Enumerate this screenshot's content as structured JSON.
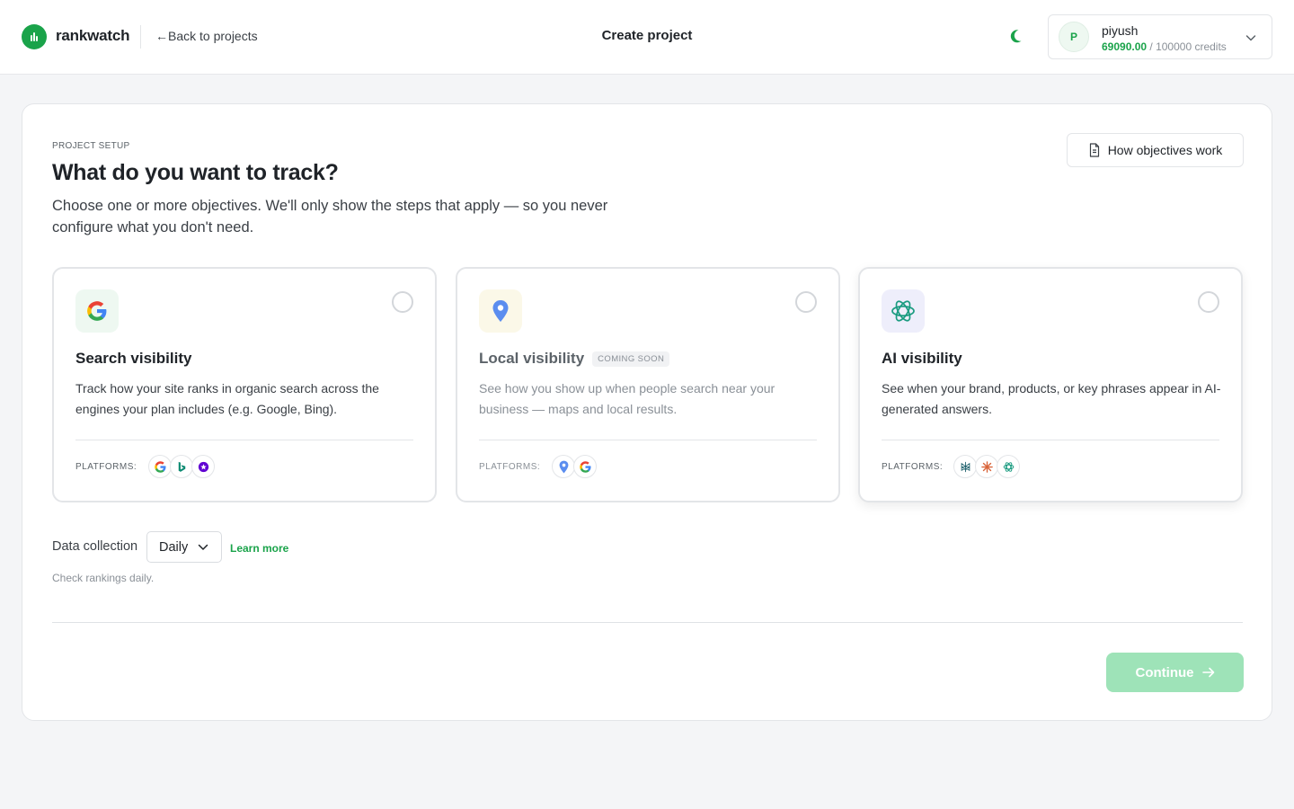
{
  "header": {
    "brand": "rankwatch",
    "back_link": "←Back to projects",
    "title": "Create project",
    "account": {
      "initial": "P",
      "name": "piyush",
      "credits_used": "69090.00",
      "credits_total": "/ 100000 credits"
    },
    "icons": [
      "rankwatch-logo-icon",
      "moon-icon",
      "chevron-down-icon"
    ],
    "accent_color": "#1aa34a"
  },
  "setup": {
    "eyebrow": "PROJECT SETUP",
    "heading": "What do you want to track?",
    "lead": "Choose one or more objectives. We'll only show the steps that apply — so you never configure what you don't need.",
    "how_button": "How objectives work"
  },
  "objectives": [
    {
      "title": "Search visibility",
      "badge": "",
      "description": "Track how your site ranks in organic search across the engines your plan includes (e.g. Google, Bing).",
      "platforms_label": "PLATFORMS:",
      "icon": "google-icon",
      "platforms": [
        "google-icon",
        "bing-icon",
        "yahoo-icon"
      ],
      "selected": false
    },
    {
      "title": "Local visibility",
      "badge": "COMING SOON",
      "description": "See how you show up when people search near your business — maps and local results.",
      "platforms_label": "PLATFORMS:",
      "icon": "map-pin-icon",
      "platforms": [
        "google-maps-icon",
        "google-icon"
      ],
      "selected": false
    },
    {
      "title": "AI visibility",
      "badge": "",
      "description": "See when your brand, products, or key phrases appear in AI-generated answers.",
      "platforms_label": "PLATFORMS:",
      "icon": "openai-icon",
      "platforms": [
        "perplexity-icon",
        "claude-icon",
        "openai-icon"
      ],
      "selected": false
    }
  ],
  "data_collection": {
    "label": "Data collection",
    "value": "Daily",
    "learn_more": "Learn more",
    "help": "Check rankings daily."
  },
  "footer": {
    "continue_label": "Continue",
    "continue_color": "#9ee3b8"
  }
}
